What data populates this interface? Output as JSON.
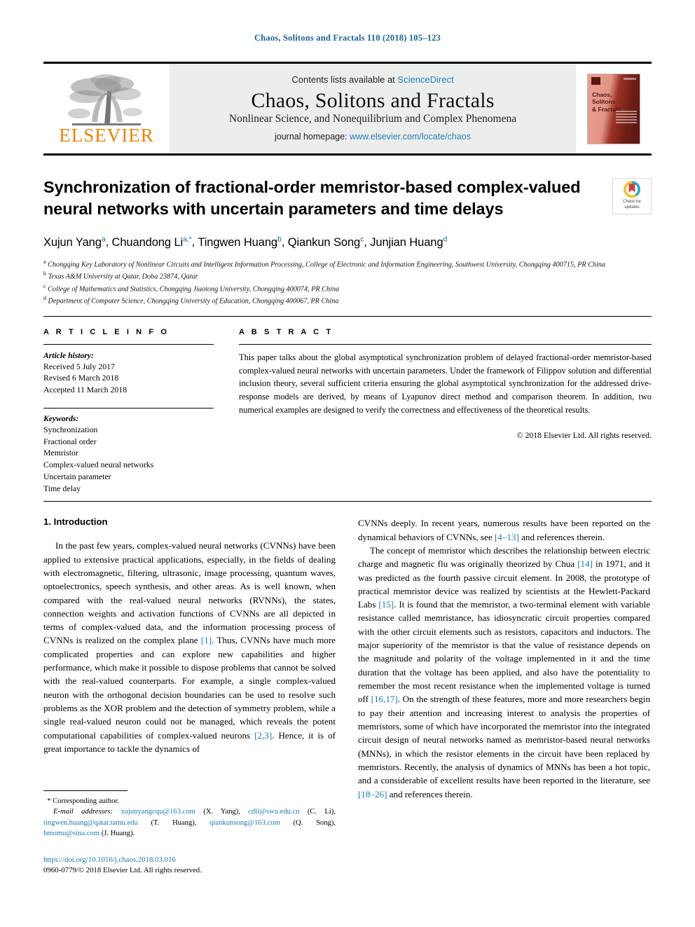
{
  "running_head": "Chaos, Solitons and Fractals 110 (2018) 105–123",
  "masthead": {
    "contents_prefix": "Contents lists available at ",
    "contents_link": "ScienceDirect",
    "journal_title": "Chaos, Solitons and Fractals",
    "journal_subtitle": "Nonlinear Science, and Nonequilibrium and Complex Phenomena",
    "homepage_prefix": "journal homepage: ",
    "homepage_url": "www.elsevier.com/locate/chaos",
    "publisher_logo_text": "ELSEVIER",
    "cover_title": "Chaos,\nSolitons\n& Fractals",
    "colors": {
      "link": "#2a7db5",
      "elsevier_orange": "#f08000",
      "masthead_bg": "#eceded"
    }
  },
  "article": {
    "title": "Synchronization of fractional-order memristor-based complex-valued neural networks with uncertain parameters and time delays",
    "authors": [
      {
        "name": "Xujun Yang",
        "sup": "a",
        "corresponding": false
      },
      {
        "name": "Chuandong Li",
        "sup": "a",
        "corresponding": true
      },
      {
        "name": "Tingwen Huang",
        "sup": "b",
        "corresponding": false
      },
      {
        "name": "Qiankun Song",
        "sup": "c",
        "corresponding": false
      },
      {
        "name": "Junjian Huang",
        "sup": "d",
        "corresponding": false
      }
    ],
    "affiliations": [
      {
        "key": "a",
        "text": "Chongqing Key Laboratory of Nonlinear Circuits and Intelligent Information Processing, College of Electronic and Information Engineering, Southwest University, Chongqing 400715, PR China"
      },
      {
        "key": "b",
        "text": "Texas A&M University at Qatar, Doha 23874, Qatar"
      },
      {
        "key": "c",
        "text": "College of Mathematics and Statistics, Chongqing Jiaotong University, Chongqing 400074, PR China"
      },
      {
        "key": "d",
        "text": "Department of Computer Science, Chongqing University of Education, Chongqing 400067, PR China"
      }
    ],
    "crossmark": {
      "line1": "Check for",
      "line2": "updates"
    }
  },
  "article_info": {
    "heading": "A R T I C L E   I N F O",
    "history_label": "Article history:",
    "history": [
      "Received 5 July 2017",
      "Revised 6 March 2018",
      "Accepted 11 March 2018"
    ],
    "keywords_label": "Keywords:",
    "keywords": [
      "Synchronization",
      "Fractional order",
      "Memristor",
      "Complex-valued neural networks",
      "Uncertain parameter",
      "Time delay"
    ]
  },
  "abstract": {
    "heading": "A B S T R A C T",
    "text": "This paper talks about the global asymptotical synchronization problem of delayed fractional-order memristor-based complex-valued neural networks with uncertain parameters. Under the framework of Filippov solution and differential inclusion theory, several sufficient criteria ensuring the global asymptotical synchronization for the addressed drive-response models are derived, by means of Lyapunov direct method and comparison theorem. In addition, two numerical examples are designed to verify the correctness and effectiveness of the theoretical results.",
    "copyright": "© 2018 Elsevier Ltd. All rights reserved."
  },
  "body": {
    "section_title": "1. Introduction",
    "left_paragraph": "In the past few years, complex-valued neural networks (CVNNs) have been applied to extensive practical applications, especially, in the fields of dealing with electromagnetic, filtering, ultrasonic, image processing, quantum waves, optoelectronics, speech synthesis, and other areas. As is well known, when compared with the real-valued neural networks (RVNNs), the states, connection weights and activation functions of CVNNs are all depicted in terms of complex-valued data, and the information processing process of CVNNs is realized on the complex plane [1]. Thus, CVNNs have much more complicated properties and can explore new capabilities and higher performance, which make it possible to dispose problems that cannot be solved with the real-valued counterparts. For example, a single complex-valued neuron with the orthogonal decision boundaries can be used to resolve such problems as the XOR problem and the detection of symmetry problem, while a single real-valued neuron could not be managed, which reveals the potent computational capabilities of complex-valued neurons [2,3]. Hence, it is of great importance to tackle the dynamics of",
    "right_paragraph_1": "CVNNs deeply. In recent years, numerous results have been reported on the dynamical behaviors of CVNNs, see [4–13] and references therein.",
    "right_paragraph_2": "The concept of memristor which describes the relationship between electric charge and magnetic flu was originally theorized by Chua [14] in 1971, and it was predicted as the fourth passive circuit element. In 2008, the prototype of practical memristor device was realized by scientists at the Hewlett-Packard Labs [15]. It is found that the memristor, a two-terminal element with variable resistance called memristance, has idiosyncratic circuit properties compared with the other circuit elements such as resistors, capacitors and inductors. The major superiority of the memristor is that the value of resistance depends on the magnitude and polarity of the voltage implemented in it and the time duration that the voltage has been applied, and also have the potentiality to remember the most recent resistance when the implemented voltage is turned off [16,17]. On the strength of these features, more and more researchers begin to pay their attention and increasing interest to analysis the properties of memristors, some of which have incorporated the memristor into the integrated circuit design of neural networks named as memristor-based neural networks (MNNs), in which the resistor elements in the circuit have been replaced by memristors. Recently, the analysis of dynamics of MNNs has been a hot topic, and a considerable of excellent results have been reported in the literature, see [18–26] and references therein."
  },
  "footnote": {
    "corresponding_marker": "*",
    "corresponding_text": "Corresponding author.",
    "email_label": "E-mail addresses:",
    "emails": [
      {
        "address": "xujunyangcqu@163.com",
        "owner": "(X. Yang)"
      },
      {
        "address": "cdli@swu.edu.cn",
        "owner": "(C. Li)"
      },
      {
        "address": "tingwen.huang@qatar.tamu.edu",
        "owner": "(T. Huang)"
      },
      {
        "address": "qiankunsong@163.com",
        "owner": "(Q. Song)"
      },
      {
        "address": "hmomu@sina.com",
        "owner": "(J. Huang)"
      }
    ],
    "doi": "https://doi.org/10.1016/j.chaos.2018.03.016",
    "issn_line": "0960-0779/© 2018 Elsevier Ltd. All rights reserved."
  }
}
